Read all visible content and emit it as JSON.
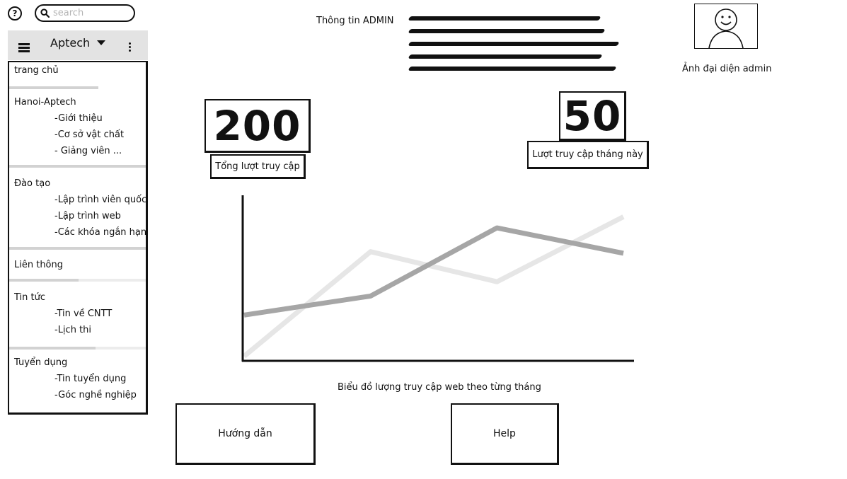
{
  "topbar": {
    "help_icon": "question-circle-icon",
    "help_glyph": "?",
    "search_placeholder": "search",
    "search_icon": "search-icon"
  },
  "sidebar": {
    "brand": "Aptech",
    "menu_icon": "hamburger-icon",
    "more_icon": "kebab-menu-icon",
    "groups": [
      {
        "title": "trang chủ",
        "items": []
      },
      {
        "title": "Hanoi-Aptech",
        "items": [
          "-Giới thiệu",
          "-Cơ sở vật chất",
          "- Giảng viên ..."
        ]
      },
      {
        "title": "Đào tạo",
        "items": [
          "-Lập trình viên quốc",
          "-Lập trình web",
          "-Các khóa ngắn hạn"
        ]
      },
      {
        "title": "Liên thông",
        "items": []
      },
      {
        "title": "Tin tức",
        "items": [
          "-Tin về CNTT",
          "-Lịch thi"
        ]
      },
      {
        "title": "Tuyển dụng",
        "items": [
          "-Tin tuyển dụng",
          "-Góc nghề nghiệp"
        ]
      }
    ]
  },
  "admin": {
    "info_label": "Thông tin ADMIN",
    "avatar_label": "Ảnh đại diện admin",
    "avatar_icon": "smiley-face-icon"
  },
  "stats": {
    "total_visits": {
      "value": "200",
      "label": "Tổng lượt truy cập"
    },
    "month_visits": {
      "value": "50",
      "label": "Lượt truy cập tháng này"
    }
  },
  "chart_data": {
    "type": "line",
    "title": "",
    "caption": "Biểu đồ lượng truy cập web theo từng tháng",
    "xlabel": "",
    "ylabel": "",
    "x": [
      1,
      2,
      3,
      4
    ],
    "ylim": [
      0,
      10
    ],
    "grid": false,
    "series": [
      {
        "color": "#e6e6e6",
        "values": [
          0.2,
          6.8,
          4.9,
          9.0
        ]
      },
      {
        "color": "#a6a6a6",
        "values": [
          2.8,
          4.0,
          8.3,
          6.7
        ]
      }
    ]
  },
  "buttons": {
    "guide_label": "Hướng dẫn",
    "help_label": "Help"
  }
}
